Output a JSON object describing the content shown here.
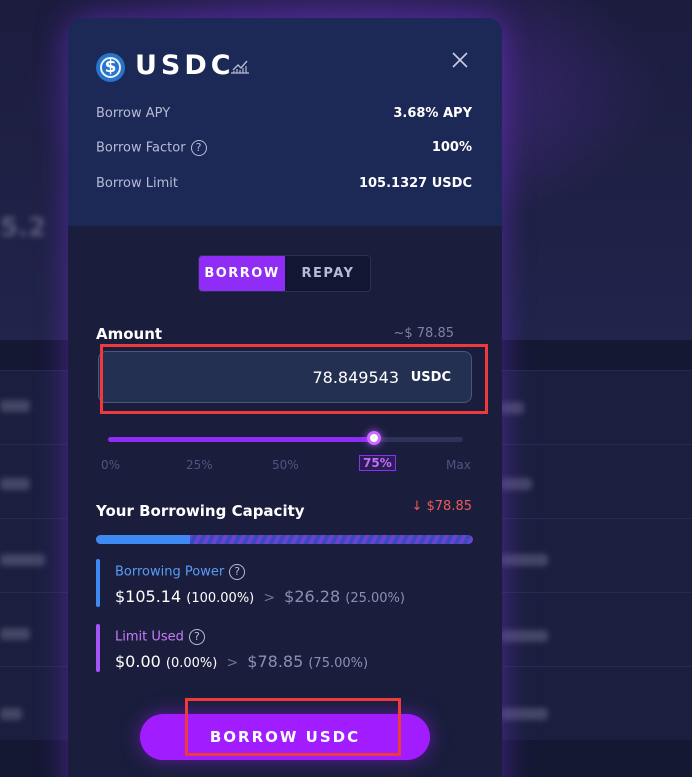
{
  "modal": {
    "token_symbol": "USDC",
    "token_icon_glyph": "$",
    "close_icon": "close-icon",
    "info": [
      {
        "label": "Borrow APY",
        "value": "3.68% APY"
      },
      {
        "label": "Borrow Factor",
        "value": "100%"
      },
      {
        "label": "Borrow Limit",
        "value": "105.1327 USDC"
      }
    ],
    "help_glyph": "?",
    "tabs": {
      "borrow": "BORROW",
      "repay": "REPAY",
      "active": "borrow"
    },
    "amount": {
      "label": "Amount",
      "usd_estimate": "~$ 78.85",
      "value": "78.849543",
      "unit": "USDC"
    },
    "slider": {
      "value_fraction": 0.75,
      "ticks": [
        "0%",
        "25%",
        "50%",
        "75%",
        "Max"
      ],
      "active_tick": "75%"
    },
    "capacity": {
      "title": "Your Borrowing Capacity",
      "change": "↓ $78.85",
      "used_fraction": 0.25
    },
    "borrowing_power": {
      "label": "Borrowing Power",
      "current": "$105.14",
      "current_pct": "(100.00%)",
      "arrow": ">",
      "after": "$26.28",
      "after_pct": "(25.00%)",
      "color": "#3f8af2"
    },
    "limit_used": {
      "label": "Limit Used",
      "current": "$0.00",
      "current_pct": "(0.00%)",
      "arrow": ">",
      "after": "$78.85",
      "after_pct": "(75.00%)",
      "color": "#a855f7"
    },
    "cta_label": "BORROW USDC"
  },
  "colors": {
    "accent": "#8f2cf5",
    "highlight": "#ee3a3a",
    "negative": "#ef5a5a"
  }
}
